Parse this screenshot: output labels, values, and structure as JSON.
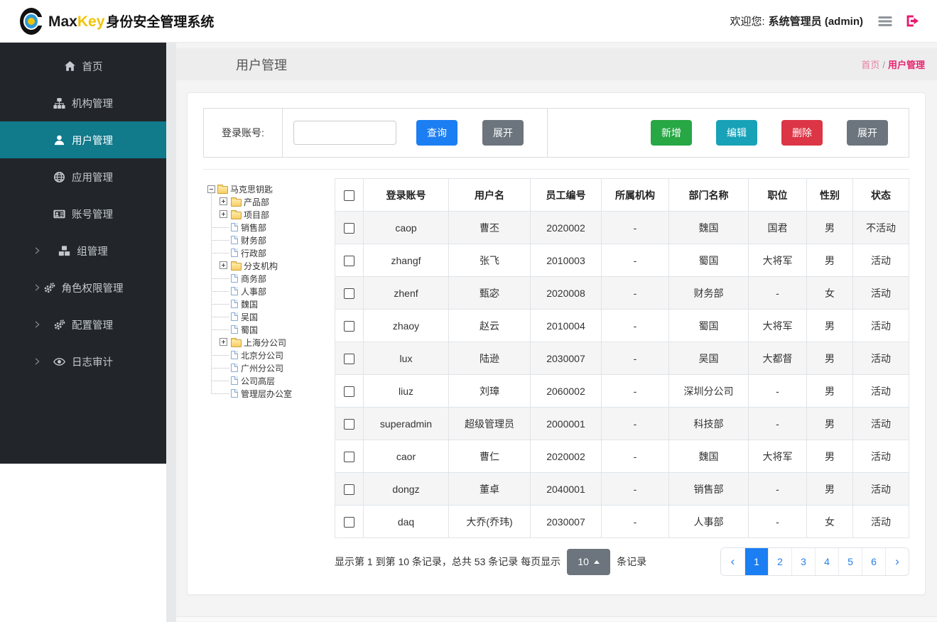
{
  "colors": {
    "primary": "#1b7ef2",
    "success": "#28a745",
    "info": "#17a2b8",
    "danger": "#dc3545",
    "secondary": "#6c757d",
    "sidebar_active": "#117a8b",
    "brand_accent": "#f2c307",
    "logout_pink": "#e8186d",
    "breadcrumb_pink": "#e8246e",
    "folder_yellow": "#f9cf62"
  },
  "header": {
    "brand_max": "Max",
    "brand_key": "Key",
    "brand_product": "身份安全管理系统",
    "welcome_label": "欢迎您:",
    "username": "系统管理员 (admin)"
  },
  "sidebar": {
    "items": [
      {
        "id": "home",
        "label": "首页",
        "icon": "home"
      },
      {
        "id": "org",
        "label": "机构管理",
        "icon": "sitemap"
      },
      {
        "id": "user",
        "label": "用户管理",
        "icon": "user",
        "active": true
      },
      {
        "id": "app",
        "label": "应用管理",
        "icon": "globe"
      },
      {
        "id": "account",
        "label": "账号管理",
        "icon": "id-card"
      },
      {
        "id": "group",
        "label": "组管理",
        "icon": "cubes",
        "expandable": true
      },
      {
        "id": "role",
        "label": "角色权限管理",
        "icon": "gears",
        "expandable": true
      },
      {
        "id": "config",
        "label": "配置管理",
        "icon": "gears",
        "expandable": true
      },
      {
        "id": "audit",
        "label": "日志审计",
        "icon": "eye",
        "expandable": true
      }
    ]
  },
  "page": {
    "title": "用户管理",
    "breadcrumb_home": "首页",
    "breadcrumb_sep": "/",
    "breadcrumb_current": "用户管理"
  },
  "filter": {
    "field_label": "登录账号:",
    "input_value": "",
    "search_label": "查询",
    "toggle_label": "展开",
    "actions": [
      {
        "id": "add",
        "label": "新增",
        "color": "#28a745"
      },
      {
        "id": "edit",
        "label": "编辑",
        "color": "#17a2b8"
      },
      {
        "id": "delete",
        "label": "删除",
        "color": "#dc3545"
      },
      {
        "id": "expand",
        "label": "展开",
        "color": "#6c757d"
      }
    ]
  },
  "tree": {
    "nodes": [
      {
        "label": "马克思钥匙",
        "level": 0,
        "icon": "folder-open",
        "toggle": "minus"
      },
      {
        "label": "产品部",
        "level": 1,
        "icon": "folder",
        "toggle": "plus"
      },
      {
        "label": "项目部",
        "level": 1,
        "icon": "folder",
        "toggle": "plus"
      },
      {
        "label": "销售部",
        "level": 1,
        "icon": "file"
      },
      {
        "label": "财务部",
        "level": 1,
        "icon": "file"
      },
      {
        "label": "行政部",
        "level": 1,
        "icon": "file"
      },
      {
        "label": "分支机构",
        "level": 1,
        "icon": "folder",
        "toggle": "plus"
      },
      {
        "label": "商务部",
        "level": 1,
        "icon": "file"
      },
      {
        "label": "人事部",
        "level": 1,
        "icon": "file"
      },
      {
        "label": "魏国",
        "level": 1,
        "icon": "file"
      },
      {
        "label": "吴国",
        "level": 1,
        "icon": "file"
      },
      {
        "label": "蜀国",
        "level": 1,
        "icon": "file"
      },
      {
        "label": "上海分公司",
        "level": 1,
        "icon": "folder",
        "toggle": "plus"
      },
      {
        "label": "北京分公司",
        "level": 1,
        "icon": "file"
      },
      {
        "label": "广州分公司",
        "level": 1,
        "icon": "file"
      },
      {
        "label": "公司高层",
        "level": 1,
        "icon": "file"
      },
      {
        "label": "管理层办公室",
        "level": 1,
        "icon": "file"
      }
    ]
  },
  "table": {
    "columns": [
      "登录账号",
      "用户名",
      "员工编号",
      "所属机构",
      "部门名称",
      "职位",
      "性别",
      "状态"
    ],
    "rows": [
      [
        "caop",
        "曹丕",
        "2020002",
        "-",
        "魏国",
        "国君",
        "男",
        "不活动"
      ],
      [
        "zhangf",
        "张飞",
        "2010003",
        "-",
        "蜀国",
        "大将军",
        "男",
        "活动"
      ],
      [
        "zhenf",
        "甄宓",
        "2020008",
        "-",
        "财务部",
        "-",
        "女",
        "活动"
      ],
      [
        "zhaoy",
        "赵云",
        "2010004",
        "-",
        "蜀国",
        "大将军",
        "男",
        "活动"
      ],
      [
        "lux",
        "陆逊",
        "2030007",
        "-",
        "吴国",
        "大都督",
        "男",
        "活动"
      ],
      [
        "liuz",
        "刘璋",
        "2060002",
        "-",
        "深圳分公司",
        "-",
        "男",
        "活动"
      ],
      [
        "superadmin",
        "超级管理员",
        "2000001",
        "-",
        "科技部",
        "-",
        "男",
        "活动"
      ],
      [
        "caor",
        "曹仁",
        "2020002",
        "-",
        "魏国",
        "大将军",
        "男",
        "活动"
      ],
      [
        "dongz",
        "董卓",
        "2040001",
        "-",
        "销售部",
        "-",
        "男",
        "活动"
      ],
      [
        "daq",
        "大乔(乔玮)",
        "2030007",
        "-",
        "人事部",
        "-",
        "女",
        "活动"
      ]
    ]
  },
  "pagination": {
    "summary_prefix": "显示第 1 到第 10 条记录，总共 53 条记录  每页显示",
    "page_size": "10",
    "summary_suffix": "条记录",
    "prev": "‹",
    "next": "›",
    "pages": [
      "1",
      "2",
      "3",
      "4",
      "5",
      "6"
    ],
    "active_page": "1"
  }
}
